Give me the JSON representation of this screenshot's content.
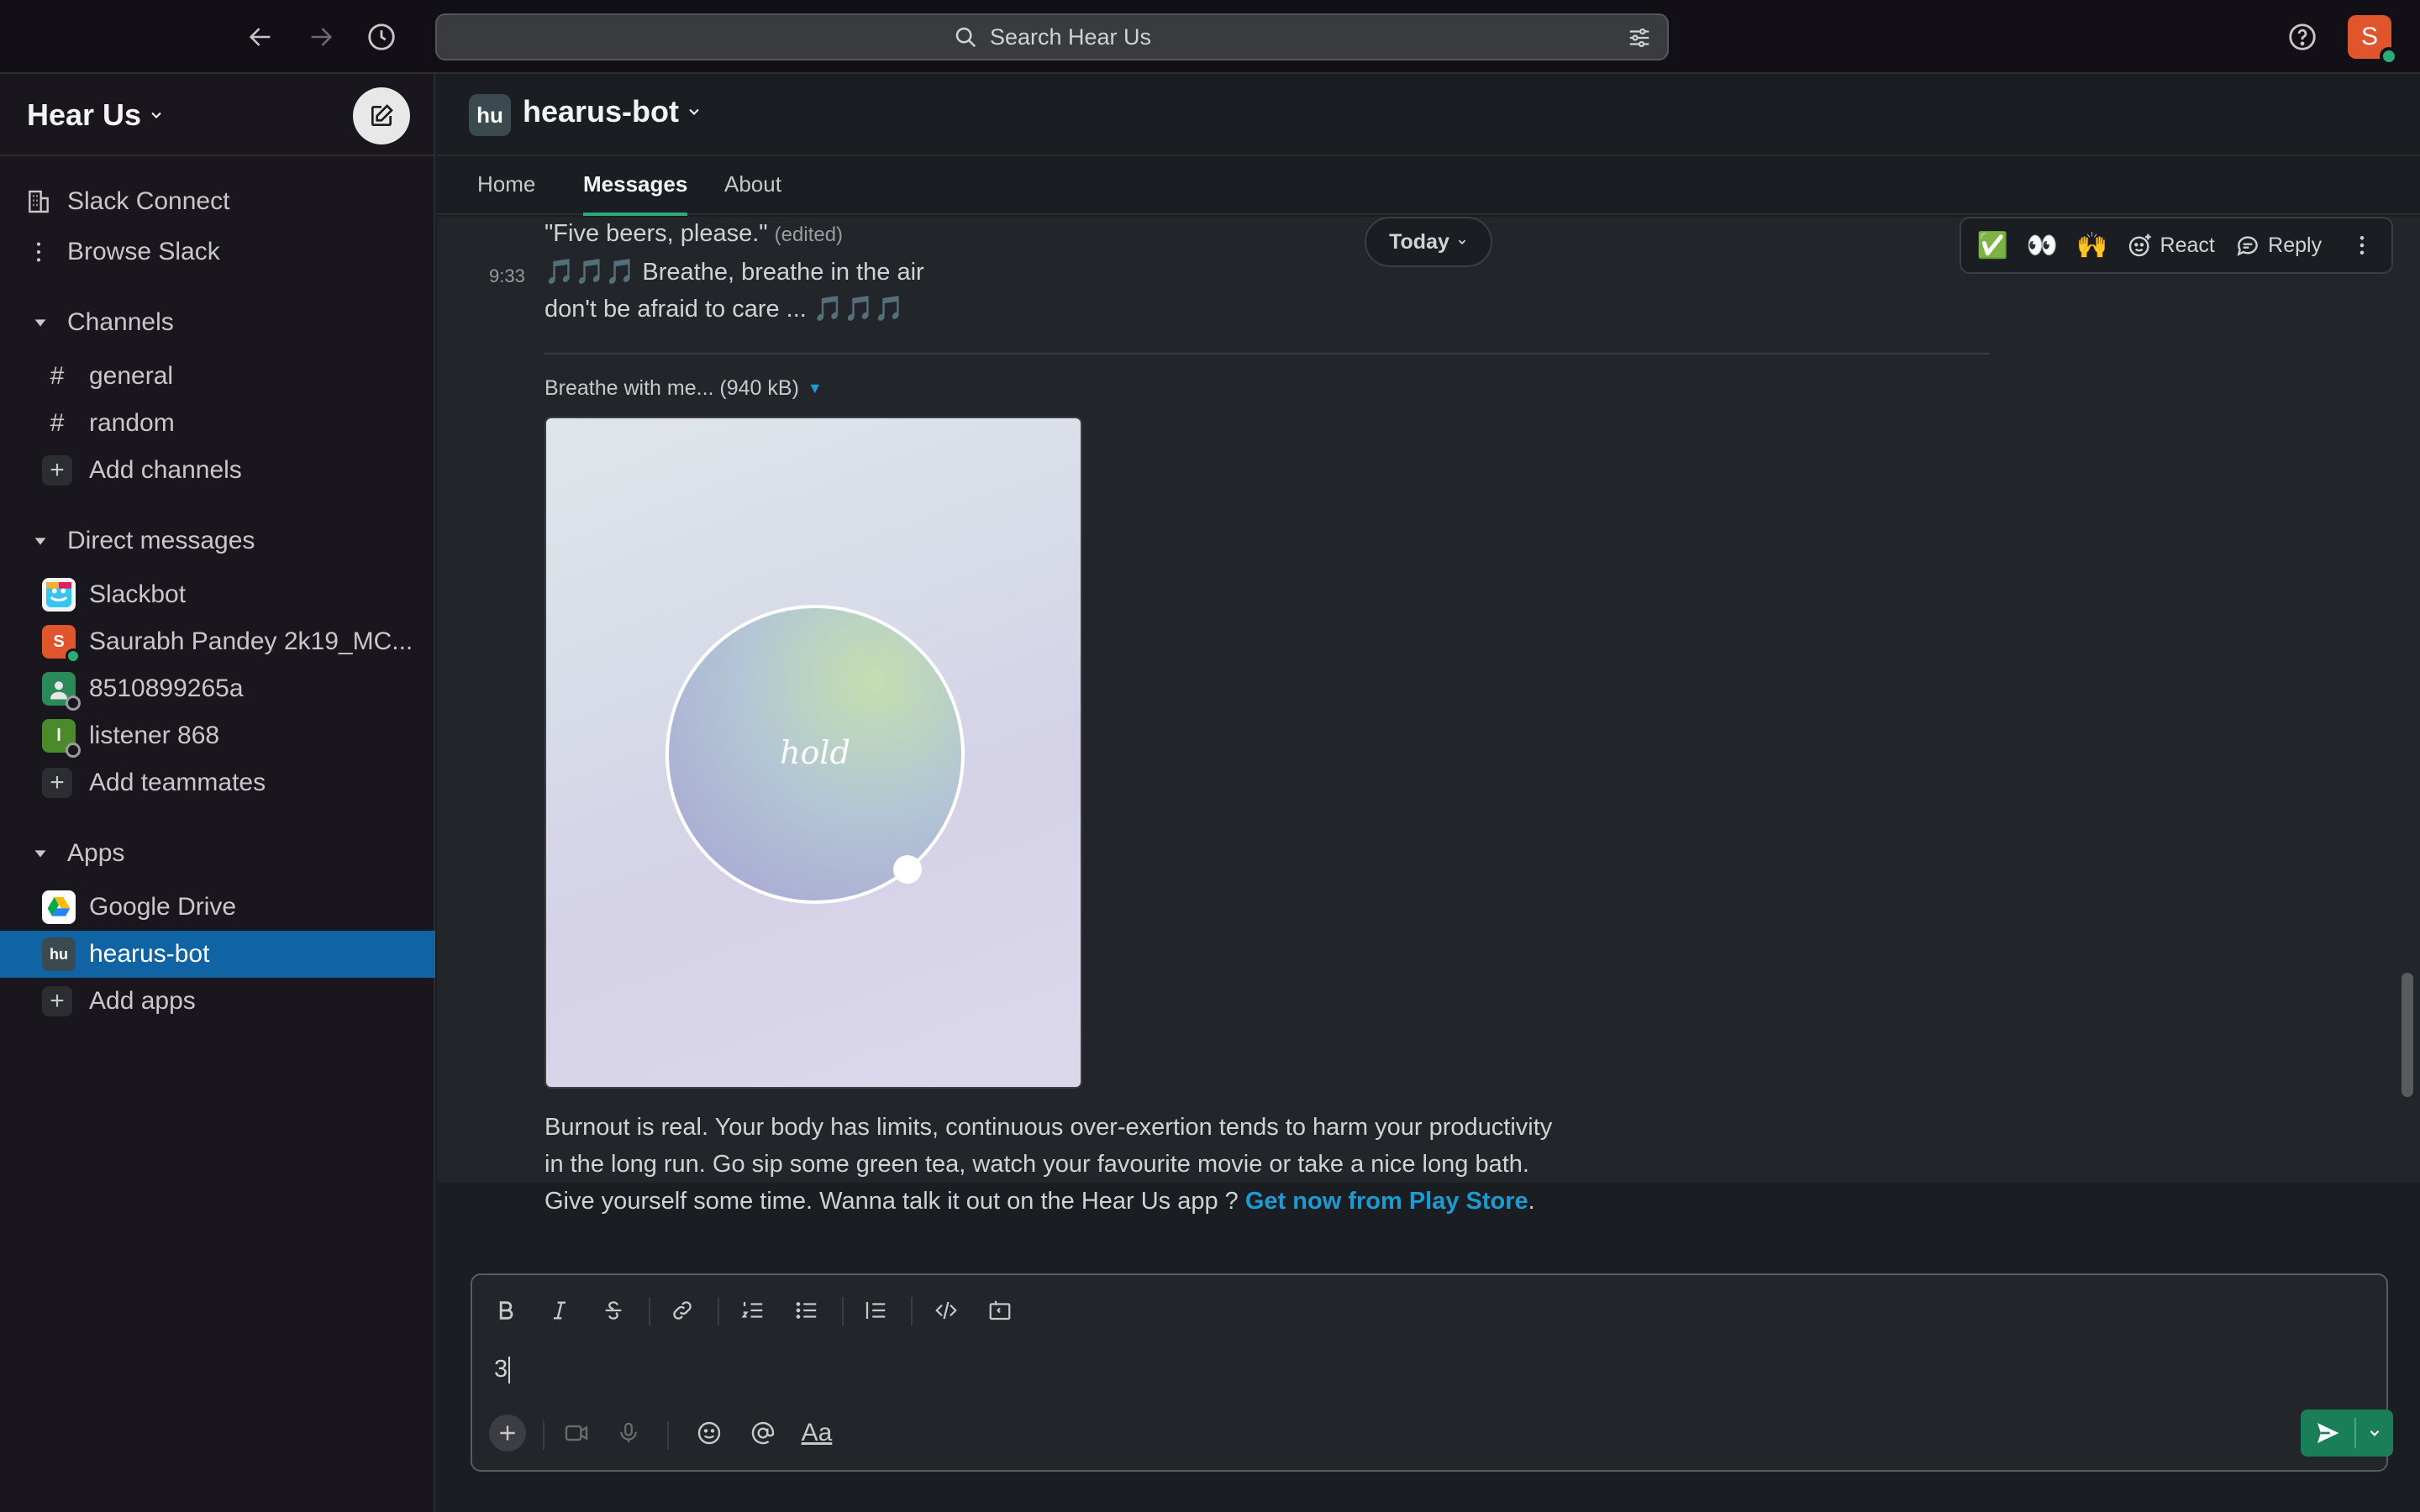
{
  "search": {
    "placeholder": "Search Hear Us"
  },
  "user": {
    "initial": "S"
  },
  "workspace": {
    "name": "Hear Us"
  },
  "sidebar": {
    "top_items": [
      {
        "label": "Slack Connect",
        "icon": "building-icon"
      },
      {
        "label": "Browse Slack",
        "icon": "more-vertical-icon"
      }
    ],
    "channels_header": "Channels",
    "channels": [
      "general",
      "random"
    ],
    "add_channels": "Add channels",
    "dms_header": "Direct messages",
    "dms": [
      {
        "label": "Slackbot",
        "color": "#e8c54a"
      },
      {
        "label": "Saurabh Pandey 2k19_MC...",
        "initial": "S",
        "color": "#e0552c"
      },
      {
        "label": "8510899265a",
        "color": "#2c8a5a"
      },
      {
        "label": "listener 868",
        "initial": "l",
        "color": "#4a8a2a"
      }
    ],
    "add_teammates": "Add teammates",
    "apps_header": "Apps",
    "apps": [
      {
        "label": "Google Drive"
      },
      {
        "label": "hearus-bot",
        "badge": "hu"
      }
    ],
    "add_apps": "Add apps"
  },
  "channel": {
    "badge": "hu",
    "name": "hearus-bot",
    "tabs": [
      "Home",
      "Messages",
      "About"
    ],
    "active_tab": "Messages"
  },
  "messages": {
    "prev_text": "\"Five beers, please.\"",
    "prev_edited": "(edited)",
    "today_label": "Today",
    "time": "9:33",
    "line1": "🎵🎵🎵 Breathe, breathe in the air",
    "line2": "don't be afraid to care ... 🎵🎵🎵",
    "file_label": "Breathe with me... (940 kB)",
    "preview_word": "hold",
    "burnout_text": "Burnout is real. Your body has limits, continuous over-exertion tends to harm your productivity in the long run. Go sip some green tea, watch your favourite movie or take a nice long bath. Give yourself some time. Wanna talk it out on the Hear Us app ? ",
    "burnout_link": "Get now from Play Store",
    "burnout_end": "."
  },
  "actions": {
    "emoji1": "✅",
    "emoji2": "👀",
    "emoji3": "🙌",
    "react": "React",
    "reply": "Reply"
  },
  "composer": {
    "value": "3"
  }
}
